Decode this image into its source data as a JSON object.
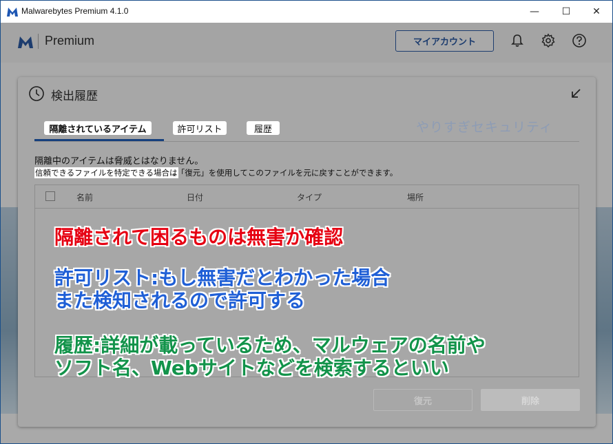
{
  "window": {
    "title": "Malwarebytes Premium  4.1.0",
    "minimize": "—",
    "maximize": "☐",
    "close": "✕"
  },
  "header": {
    "brand": "Premium",
    "account_button": "マイアカウント",
    "icons": [
      "bell-icon",
      "gear-icon",
      "help-icon"
    ]
  },
  "panel": {
    "title": "検出履歴",
    "tabs": [
      {
        "label": "隔離されているアイテム",
        "active": true
      },
      {
        "label": "許可リスト",
        "active": false
      },
      {
        "label": "履歴",
        "active": false
      }
    ],
    "watermark": "やりすぎセキュリティ",
    "info_line1": "隔離中のアイテムは脅威とはなりません。",
    "info_line2a": "信頼できるファイルを特定できる場合は",
    "info_line2b": "、「復元」を使用してこのファイルを元に戻すことができます。",
    "columns": [
      "名前",
      "日付",
      "タイプ",
      "場所"
    ],
    "restore_button": "復元",
    "delete_button": "削除"
  },
  "annotations": {
    "line1": "隔離されて困るものは無害か確認",
    "line2": "許可リスト:もし無害だとわかった場合",
    "line3": "また検知されるので許可する",
    "line4": "履歴:詳細が載っているため、マルウェアの名前や",
    "line5": "ソフト名、Webサイトなどを検索するといい",
    "colors": {
      "red": "#e60012",
      "blue": "#1f5fd6",
      "green": "#12934a"
    }
  }
}
